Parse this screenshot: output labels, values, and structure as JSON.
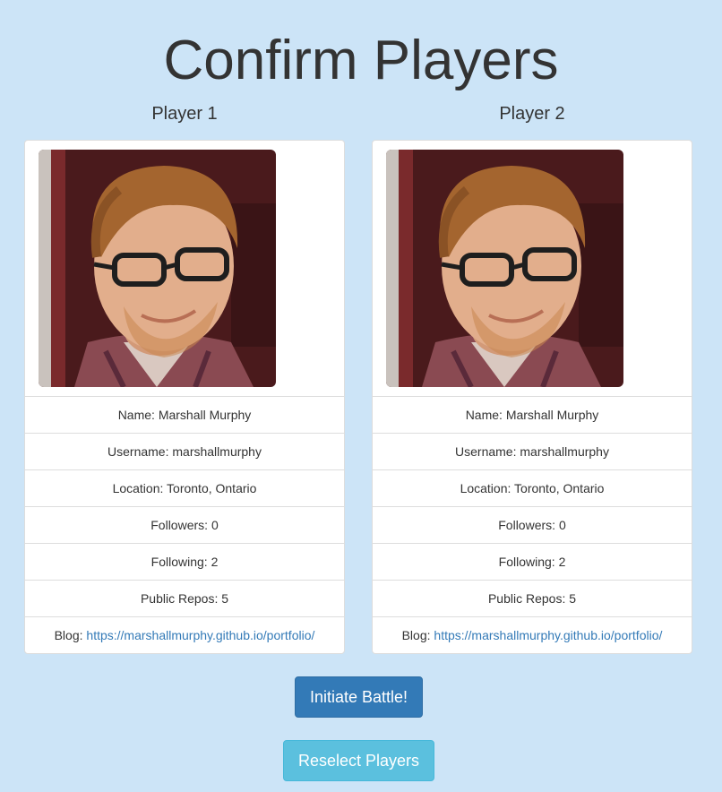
{
  "page": {
    "title": "Confirm Players"
  },
  "players": [
    {
      "heading": "Player 1",
      "name_label": "Name:",
      "name": "Marshall Murphy",
      "username_label": "Username:",
      "username": "marshallmurphy",
      "location_label": "Location:",
      "location": "Toronto, Ontario",
      "followers_label": "Followers:",
      "followers": "0",
      "following_label": "Following:",
      "following": "2",
      "repos_label": "Public Repos:",
      "repos": "5",
      "blog_label": "Blog:",
      "blog": "https://marshallmurphy.github.io/portfolio/"
    },
    {
      "heading": "Player 2",
      "name_label": "Name:",
      "name": "Marshall Murphy",
      "username_label": "Username:",
      "username": "marshallmurphy",
      "location_label": "Location:",
      "location": "Toronto, Ontario",
      "followers_label": "Followers:",
      "followers": "0",
      "following_label": "Following:",
      "following": "2",
      "repos_label": "Public Repos:",
      "repos": "5",
      "blog_label": "Blog:",
      "blog": "https://marshallmurphy.github.io/portfolio/"
    }
  ],
  "actions": {
    "initiate_label": "Initiate Battle!",
    "reselect_label": "Reselect Players"
  },
  "colors": {
    "background": "#cce4f7",
    "primary_button": "#337ab7",
    "info_button": "#5bc0de",
    "link": "#337ab7"
  }
}
